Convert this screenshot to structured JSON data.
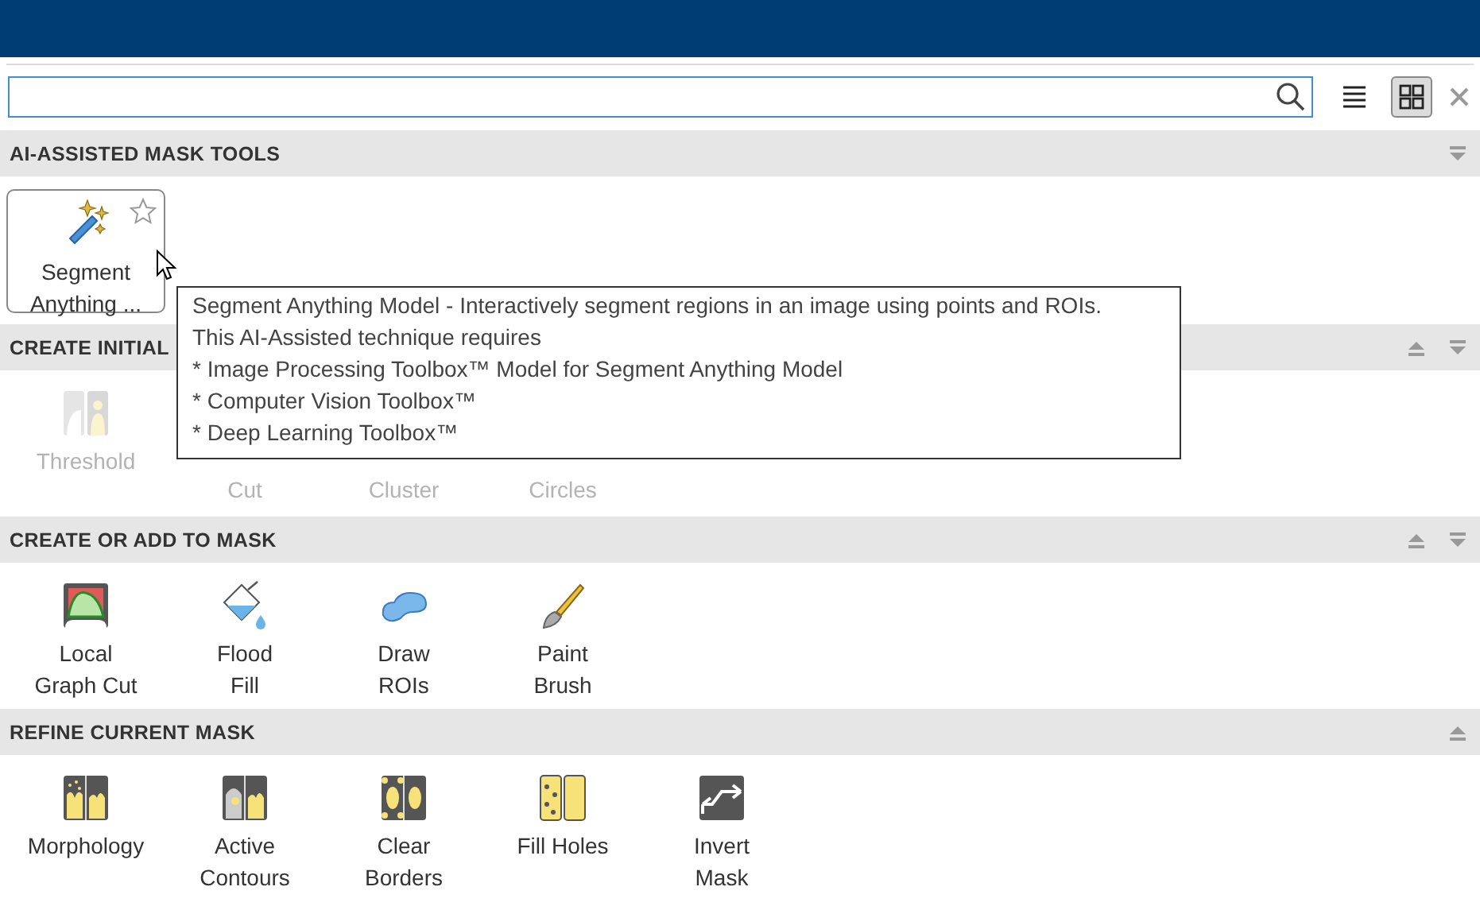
{
  "view_buttons": [
    {
      "kind": "list",
      "selected": false
    },
    {
      "kind": "grid",
      "selected": true
    }
  ],
  "sections": [
    {
      "title": "AI-ASSISTED MASK TOOLS",
      "move_up": false,
      "move_down": true,
      "items": [
        {
          "lines": [
            "Segment",
            "Anything ..."
          ],
          "disabled": false,
          "hovered": true,
          "favorite": false
        }
      ]
    },
    {
      "title": "CREATE INITIAL",
      "move_up": true,
      "move_down": true,
      "items": [
        {
          "lines": [
            "Threshold"
          ],
          "disabled": true,
          "hovered": false
        },
        {
          "lines": [
            "Cut"
          ],
          "disabled": true,
          "hovered": false
        },
        {
          "lines": [
            "Cluster"
          ],
          "disabled": true,
          "hovered": false
        },
        {
          "lines": [
            "Circles"
          ],
          "disabled": true,
          "hovered": false
        }
      ]
    },
    {
      "title": "CREATE OR ADD TO MASK",
      "move_up": true,
      "move_down": true,
      "items": [
        {
          "lines": [
            "Local",
            "Graph Cut"
          ],
          "disabled": false,
          "hovered": false
        },
        {
          "lines": [
            "Flood",
            "Fill"
          ],
          "disabled": false,
          "hovered": false
        },
        {
          "lines": [
            "Draw",
            "ROIs"
          ],
          "disabled": false,
          "hovered": false
        },
        {
          "lines": [
            "Paint",
            "Brush"
          ],
          "disabled": false,
          "hovered": false
        }
      ]
    },
    {
      "title": "REFINE CURRENT MASK",
      "move_up": true,
      "move_down": false,
      "items": [
        {
          "lines": [
            "Morphology"
          ],
          "disabled": false,
          "hovered": false
        },
        {
          "lines": [
            "Active",
            "Contours"
          ],
          "disabled": false,
          "hovered": false
        },
        {
          "lines": [
            "Clear",
            "Borders"
          ],
          "disabled": false,
          "hovered": false
        },
        {
          "lines": [
            "Fill Holes"
          ],
          "disabled": false,
          "hovered": false
        },
        {
          "lines": [
            "Invert",
            "Mask"
          ],
          "disabled": false,
          "hovered": false
        }
      ]
    }
  ],
  "tooltip": {
    "lines": [
      "Segment Anything Model - Interactively segment regions in an image using points and ROIs.",
      "This AI-Assisted technique requires",
      "* Image Processing Toolbox™ Model for Segment Anything Model",
      "* Computer Vision Toolbox™",
      "* Deep Learning Toolbox™"
    ]
  }
}
